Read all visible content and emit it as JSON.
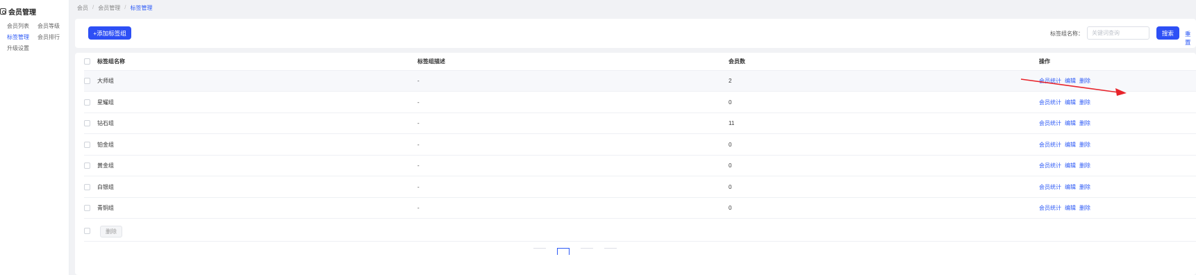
{
  "sidebar": {
    "header": "会员管理",
    "items": [
      {
        "label": "会员列表",
        "active": false
      },
      {
        "label": "会员等级",
        "active": false
      },
      {
        "label": "标签管理",
        "active": true
      },
      {
        "label": "会员排行",
        "active": false
      },
      {
        "label": "升级设置",
        "active": false
      }
    ]
  },
  "breadcrumb": {
    "items": [
      "会员",
      "会员管理",
      "标签管理"
    ],
    "separator": "/"
  },
  "toolbar": {
    "add_label": "+添加标签组",
    "filter_label": "标签组名称：",
    "filter_placeholder": "关键词查询",
    "filter_value": "",
    "search_label": "搜索",
    "reset_label": "重置"
  },
  "table": {
    "columns": [
      "标签组名称",
      "标签组描述",
      "会员数",
      "操作"
    ],
    "rows": [
      {
        "name": "大师组",
        "desc": "-",
        "count": "2"
      },
      {
        "name": "星耀组",
        "desc": "-",
        "count": "0"
      },
      {
        "name": "钻石组",
        "desc": "-",
        "count": "11"
      },
      {
        "name": "铂金组",
        "desc": "-",
        "count": "0"
      },
      {
        "name": "黄金组",
        "desc": "-",
        "count": "0"
      },
      {
        "name": "白银组",
        "desc": "-",
        "count": "0"
      },
      {
        "name": "青铜组",
        "desc": "-",
        "count": "0"
      }
    ],
    "row_actions": [
      "会员统计",
      "编辑",
      "删除"
    ],
    "bulk_delete_label": "删除"
  },
  "colors": {
    "accent": "#2d4ff5",
    "link": "#2d5af6",
    "annotation_arrow": "#e8232a"
  },
  "icons": {
    "sidebar_header": "member-management-icon",
    "annotation": "red-arrow-icon"
  }
}
